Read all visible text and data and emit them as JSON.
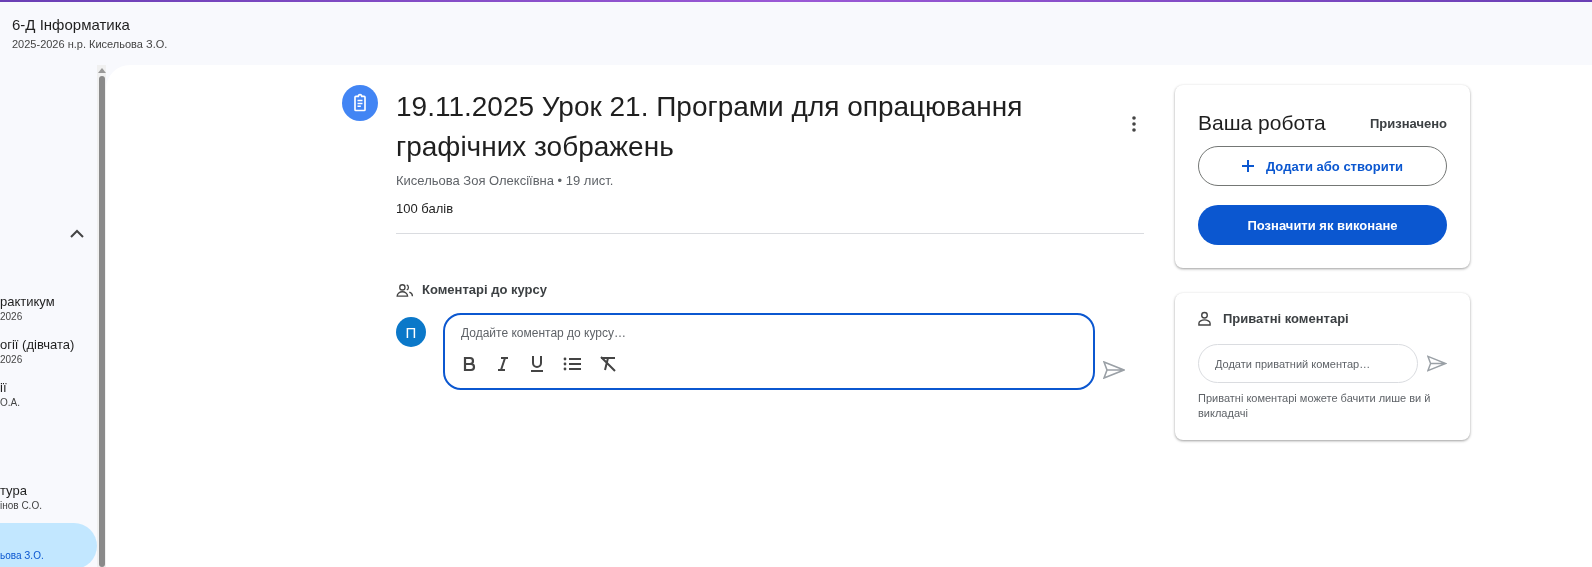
{
  "header": {
    "title": "6-Д Інформатика",
    "subtitle": "2025-2026 н.р. Кисельова З.О."
  },
  "sidebar": {
    "expanded": true,
    "items": [
      {
        "title": "рактикум",
        "subtitle": "2026",
        "selected": false
      },
      {
        "title": "огії (дівчата)",
        "subtitle": "2026",
        "selected": false
      },
      {
        "title": "ії",
        "subtitle": "О.А.",
        "selected": false
      },
      {
        "title": "тура",
        "subtitle": "інов С.О.",
        "selected": false
      },
      {
        "subtitle": "ьова З.О.",
        "selected": true
      }
    ]
  },
  "assignment": {
    "title": "19.11.2025 Урок 21. Програми для опрацювання графічних зображень",
    "meta": "Кисельова Зоя Олексіївна • 19 лист.",
    "points": "100 балів"
  },
  "class_comments": {
    "heading": "Коментарі до курсу",
    "avatar": "П",
    "placeholder": "Додайте коментар до курсу…"
  },
  "your_work": {
    "title": "Ваша робота",
    "status": "Призначено",
    "add_button": "Додати або створити",
    "done_button": "Позначити як виконане"
  },
  "private_comments": {
    "heading": "Приватні коментарі",
    "placeholder": "Додати приватний коментар…",
    "note": "Приватні коментарі можете бачити лише ви й викладачі"
  }
}
